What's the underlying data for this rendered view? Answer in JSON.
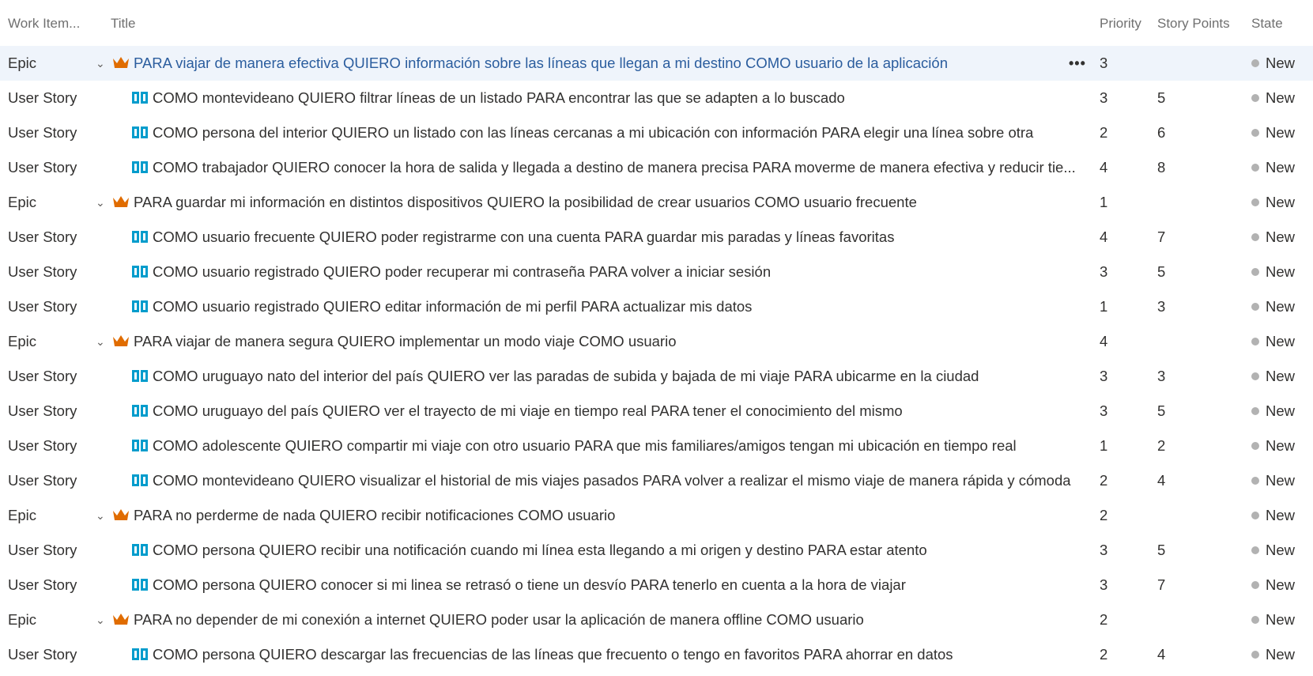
{
  "columns": {
    "work_item": "Work Item...",
    "title": "Title",
    "priority": "Priority",
    "story_points": "Story Points",
    "state": "State"
  },
  "colors": {
    "epic": "#e06c00",
    "story": "#009ccc",
    "state_new": "#b2b2b2",
    "selected_row": "#eff4fb"
  },
  "rows": [
    {
      "type": "Epic",
      "title": "PARA viajar de manera efectiva QUIERO información sobre las líneas que llegan a mi destino COMO usuario de la aplicación",
      "priority": "3",
      "points": "",
      "state": "New",
      "more": "•••",
      "toggle": "⌄",
      "icon": "crown-icon"
    },
    {
      "type": "User Story",
      "title": "COMO montevideano QUIERO filtrar líneas de un listado PARA encontrar las que se adapten a lo buscado",
      "priority": "3",
      "points": "5",
      "state": "New",
      "icon": "book-icon"
    },
    {
      "type": "User Story",
      "title": "COMO persona del interior QUIERO un listado con las líneas cercanas a mi ubicación con información PARA elegir una línea sobre otra",
      "priority": "2",
      "points": "6",
      "state": "New",
      "icon": "book-icon"
    },
    {
      "type": "User Story",
      "title": "COMO trabajador QUIERO conocer la hora de salida y llegada a destino de manera precisa PARA moverme de manera efectiva y reducir tie...",
      "priority": "4",
      "points": "8",
      "state": "New",
      "icon": "book-icon"
    },
    {
      "type": "Epic",
      "title": "PARA guardar mi información en distintos dispositivos QUIERO la posibilidad de crear usuarios COMO usuario frecuente",
      "priority": "1",
      "points": "",
      "state": "New",
      "toggle": "⌄",
      "icon": "crown-icon"
    },
    {
      "type": "User Story",
      "title": "COMO usuario frecuente QUIERO poder registrarme con una cuenta PARA guardar mis paradas y líneas favoritas",
      "priority": "4",
      "points": "7",
      "state": "New",
      "icon": "book-icon"
    },
    {
      "type": "User Story",
      "title": "COMO usuario registrado QUIERO poder recuperar mi contraseña PARA volver a iniciar sesión",
      "priority": "3",
      "points": "5",
      "state": "New",
      "icon": "book-icon"
    },
    {
      "type": "User Story",
      "title": "COMO usuario registrado QUIERO editar información de mi perfil PARA actualizar mis datos",
      "priority": "1",
      "points": "3",
      "state": "New",
      "icon": "book-icon"
    },
    {
      "type": "Epic",
      "title": "PARA viajar de manera segura QUIERO implementar un modo viaje COMO usuario",
      "priority": "4",
      "points": "",
      "state": "New",
      "toggle": "⌄",
      "icon": "crown-icon"
    },
    {
      "type": "User Story",
      "title": "COMO uruguayo nato del interior del país QUIERO ver las paradas de subida y bajada de mi viaje PARA ubicarme en la ciudad",
      "priority": "3",
      "points": "3",
      "state": "New",
      "icon": "book-icon"
    },
    {
      "type": "User Story",
      "title": "COMO uruguayo del país QUIERO ver el trayecto de mi viaje en tiempo real PARA tener el conocimiento del mismo",
      "priority": "3",
      "points": "5",
      "state": "New",
      "icon": "book-icon"
    },
    {
      "type": "User Story",
      "title": "COMO adolescente QUIERO compartir mi viaje con otro usuario PARA que mis familiares/amigos tengan mi ubicación en tiempo real",
      "priority": "1",
      "points": "2",
      "state": "New",
      "icon": "book-icon"
    },
    {
      "type": "User Story",
      "title": "COMO montevideano QUIERO visualizar el historial de mis viajes pasados PARA volver a realizar el mismo viaje de manera rápida y cómoda",
      "priority": "2",
      "points": "4",
      "state": "New",
      "icon": "book-icon"
    },
    {
      "type": "Epic",
      "title": "PARA no perderme de nada QUIERO recibir notificaciones COMO usuario",
      "priority": "2",
      "points": "",
      "state": "New",
      "toggle": "⌄",
      "icon": "crown-icon"
    },
    {
      "type": "User Story",
      "title": "COMO persona QUIERO recibir una notificación cuando mi línea esta llegando a mi origen y destino PARA estar atento",
      "priority": "3",
      "points": "5",
      "state": "New",
      "icon": "book-icon"
    },
    {
      "type": "User Story",
      "title": "COMO persona QUIERO conocer si mi linea se retrasó o tiene un desvío PARA tenerlo en cuenta a la hora de viajar",
      "priority": "3",
      "points": "7",
      "state": "New",
      "icon": "book-icon"
    },
    {
      "type": "Epic",
      "title": "PARA no depender de mi conexión a internet QUIERO poder usar la aplicación de manera offline COMO usuario",
      "priority": "2",
      "points": "",
      "state": "New",
      "toggle": "⌄",
      "icon": "crown-icon"
    },
    {
      "type": "User Story",
      "title": "COMO persona QUIERO descargar las frecuencias de las líneas que frecuento o tengo en favoritos PARA ahorrar en datos",
      "priority": "2",
      "points": "4",
      "state": "New",
      "icon": "book-icon"
    }
  ]
}
